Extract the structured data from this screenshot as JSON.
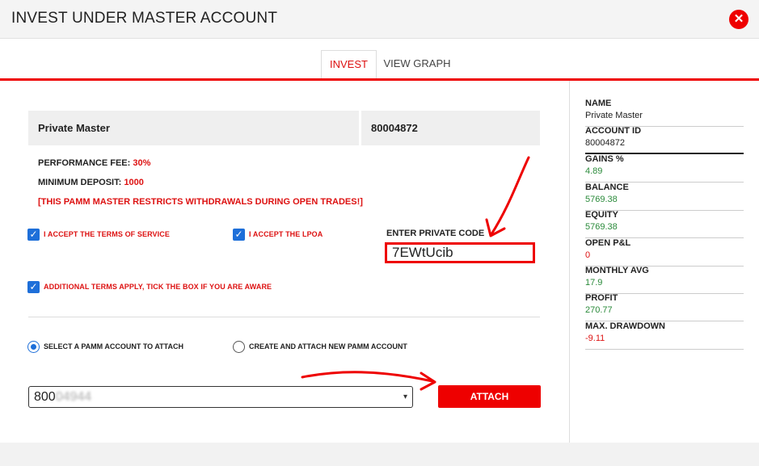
{
  "header": {
    "title": "INVEST UNDER MASTER ACCOUNT",
    "close_icon": "close-icon"
  },
  "tabs": [
    {
      "label": "INVEST",
      "active": true
    },
    {
      "label": "VIEW GRAPH",
      "active": false
    }
  ],
  "master": {
    "name": "Private Master",
    "account_id": "80004872",
    "performance_fee_label": "PERFORMANCE FEE:",
    "performance_fee_value": "30%",
    "minimum_deposit_label": "MINIMUM DEPOSIT:",
    "minimum_deposit_value": "1000",
    "warning": "[THIS PAMM MASTER RESTRICTS WITHDRAWALS DURING OPEN TRADES!]"
  },
  "checkboxes": [
    {
      "label": "I ACCEPT THE TERMS OF SERVICE",
      "checked": true
    },
    {
      "label": "I ACCEPT THE LPOA",
      "checked": true
    },
    {
      "label": "ADDITIONAL TERMS APPLY, TICK THE BOX IF YOU ARE AWARE",
      "checked": true
    }
  ],
  "private_code": {
    "label": "ENTER PRIVATE CODE",
    "value": "7EWtUcib"
  },
  "radios": [
    {
      "label": "SELECT A PAMM ACCOUNT TO ATTACH",
      "selected": true
    },
    {
      "label": "CREATE AND ATTACH NEW PAMM ACCOUNT",
      "selected": false
    }
  ],
  "account_select": {
    "visible": "800",
    "obscured": "04944"
  },
  "attach_button": {
    "label": "ATTACH"
  },
  "sidebar": [
    {
      "label": "NAME",
      "value": "Private Master",
      "color": "plain"
    },
    {
      "label": "ACCOUNT ID",
      "value": "80004872",
      "color": "plain"
    },
    {
      "label": "GAINS %",
      "value": "4.89",
      "color": "green"
    },
    {
      "label": "BALANCE",
      "value": "5769.38",
      "color": "green"
    },
    {
      "label": "EQUITY",
      "value": "5769.38",
      "color": "green"
    },
    {
      "label": "OPEN P&L",
      "value": "0",
      "color": "red"
    },
    {
      "label": "MONTHLY AVG",
      "value": "17.9",
      "color": "green"
    },
    {
      "label": "PROFIT",
      "value": "270.77",
      "color": "green"
    },
    {
      "label": "MAX. DRAWDOWN",
      "value": "-9.11",
      "color": "red"
    }
  ],
  "colors": {
    "accent": "#ee0000",
    "positive": "#2a8a3a",
    "negative": "#dd1111",
    "checkbox": "#1e6fd9"
  }
}
